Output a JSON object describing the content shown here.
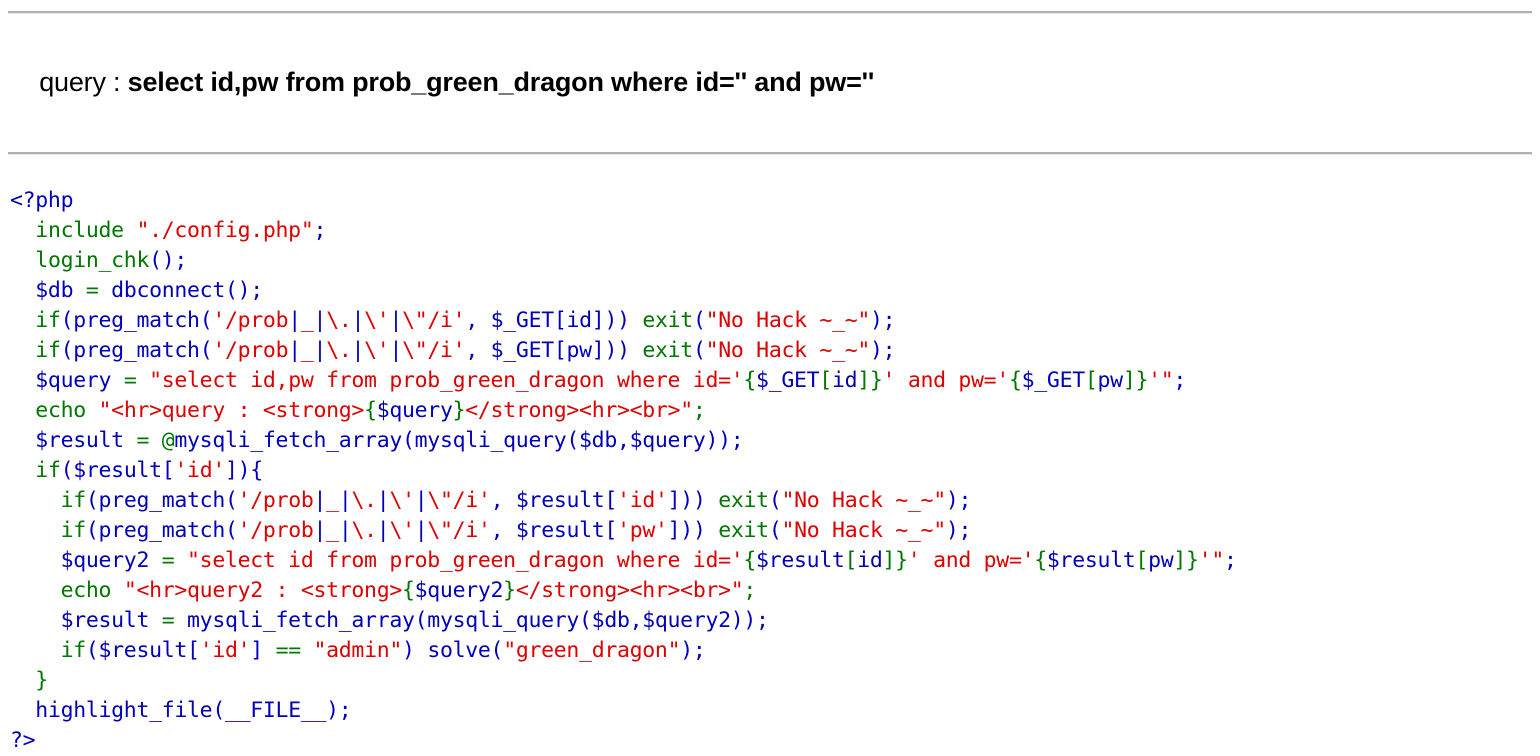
{
  "colors": {
    "keyword_blue": "#0000BB",
    "string_red": "#DD0000",
    "default_green": "#007700",
    "hr_gray": "#b0b0b0",
    "background": "#ffffff",
    "text": "#000000"
  },
  "echo_output": {
    "label": "query : ",
    "query": "select id,pw from prob_green_dragon where id='' and pw=''"
  },
  "source": {
    "open_tag": "<?php",
    "close_tag": "?>",
    "lines": [
      {
        "id": "line-1",
        "text": "<?php"
      },
      {
        "id": "line-2",
        "text": "  include \"./config.php\";"
      },
      {
        "id": "line-3",
        "text": "  login_chk();"
      },
      {
        "id": "line-4",
        "text": "  $db = dbconnect();"
      },
      {
        "id": "line-5",
        "text": "  if(preg_match('/prob|_|\\.|\\'|\\\"/i', $_GET[id])) exit(\"No Hack ~_~\");"
      },
      {
        "id": "line-6",
        "text": "  if(preg_match('/prob|_|\\.|\\'|\\\"/i', $_GET[pw])) exit(\"No Hack ~_~\");"
      },
      {
        "id": "line-7",
        "text": "  $query = \"select id,pw from prob_green_dragon where id='{$_GET[id]}' and pw='{$_GET[pw]}'\";"
      },
      {
        "id": "line-8",
        "text": "  echo \"<hr>query : <strong>{$query}</strong><hr><br>\";"
      },
      {
        "id": "line-9",
        "text": "  $result = @mysqli_fetch_array(mysqli_query($db,$query));"
      },
      {
        "id": "line-10",
        "text": "  if($result['id']){"
      },
      {
        "id": "line-11",
        "text": "    if(preg_match('/prob|_|\\.|\\'|\\\"/i', $result['id'])) exit(\"No Hack ~_~\");"
      },
      {
        "id": "line-12",
        "text": "    if(preg_match('/prob|_|\\.|\\'|\\\"/i', $result['pw'])) exit(\"No Hack ~_~\");"
      },
      {
        "id": "line-13",
        "text": "    $query2 = \"select id from prob_green_dragon where id='{$result[id]}' and pw='{$result[pw]}'\";"
      },
      {
        "id": "line-14",
        "text": "    echo \"<hr>query2 : <strong>{$query2}</strong><hr><br>\";"
      },
      {
        "id": "line-15",
        "text": "    $result = mysqli_fetch_array(mysqli_query($db,$query2));"
      },
      {
        "id": "line-16",
        "text": "    if($result['id'] == \"admin\") solve(\"green_dragon\");"
      },
      {
        "id": "line-17",
        "text": "  }"
      },
      {
        "id": "line-18",
        "text": "  highlight_file(__FILE__);"
      },
      {
        "id": "line-19",
        "text": "?>"
      }
    ],
    "tokens": [
      [
        {
          "c": "b",
          "t": "<?php"
        }
      ],
      [
        {
          "c": "b",
          "t": "  "
        },
        {
          "c": "g",
          "t": "include "
        },
        {
          "c": "r",
          "t": "\"./config.php\""
        },
        {
          "c": "b",
          "t": ";"
        }
      ],
      [
        {
          "c": "b",
          "t": "  "
        },
        {
          "c": "g",
          "t": "login_chk"
        },
        {
          "c": "b",
          "t": "();"
        }
      ],
      [
        {
          "c": "b",
          "t": "  $db "
        },
        {
          "c": "g",
          "t": "= "
        },
        {
          "c": "b",
          "t": "dbconnect();"
        }
      ],
      [
        {
          "c": "b",
          "t": "  "
        },
        {
          "c": "g",
          "t": "if"
        },
        {
          "c": "b",
          "t": "("
        },
        {
          "c": "b",
          "t": "preg_match"
        },
        {
          "c": "b",
          "t": "("
        },
        {
          "c": "r",
          "t": "'/prob"
        },
        {
          "c": "b",
          "t": "|"
        },
        {
          "c": "r",
          "t": "_"
        },
        {
          "c": "b",
          "t": "|"
        },
        {
          "c": "r",
          "t": "\\."
        },
        {
          "c": "b",
          "t": "|"
        },
        {
          "c": "r",
          "t": "\\'"
        },
        {
          "c": "b",
          "t": "|"
        },
        {
          "c": "r",
          "t": "\\\"/i'"
        },
        {
          "c": "b",
          "t": ", $_GET["
        },
        {
          "c": "b",
          "t": "id"
        },
        {
          "c": "b",
          "t": "])) "
        },
        {
          "c": "g",
          "t": "exit"
        },
        {
          "c": "b",
          "t": "("
        },
        {
          "c": "r",
          "t": "\"No Hack ~_~\""
        },
        {
          "c": "b",
          "t": ");"
        }
      ],
      [
        {
          "c": "b",
          "t": "  "
        },
        {
          "c": "g",
          "t": "if"
        },
        {
          "c": "b",
          "t": "("
        },
        {
          "c": "b",
          "t": "preg_match"
        },
        {
          "c": "b",
          "t": "("
        },
        {
          "c": "r",
          "t": "'/prob"
        },
        {
          "c": "b",
          "t": "|"
        },
        {
          "c": "r",
          "t": "_"
        },
        {
          "c": "b",
          "t": "|"
        },
        {
          "c": "r",
          "t": "\\."
        },
        {
          "c": "b",
          "t": "|"
        },
        {
          "c": "r",
          "t": "\\'"
        },
        {
          "c": "b",
          "t": "|"
        },
        {
          "c": "r",
          "t": "\\\"/i'"
        },
        {
          "c": "b",
          "t": ", $_GET["
        },
        {
          "c": "b",
          "t": "pw"
        },
        {
          "c": "b",
          "t": "])) "
        },
        {
          "c": "g",
          "t": "exit"
        },
        {
          "c": "b",
          "t": "("
        },
        {
          "c": "r",
          "t": "\"No Hack ~_~\""
        },
        {
          "c": "b",
          "t": ");"
        }
      ],
      [
        {
          "c": "b",
          "t": "  $query "
        },
        {
          "c": "g",
          "t": "= "
        },
        {
          "c": "r",
          "t": "\"select id,pw from prob_green_dragon where id='"
        },
        {
          "c": "g",
          "t": "{"
        },
        {
          "c": "b",
          "t": "$_GET"
        },
        {
          "c": "g",
          "t": "["
        },
        {
          "c": "b",
          "t": "id"
        },
        {
          "c": "g",
          "t": "]}"
        },
        {
          "c": "r",
          "t": "' and pw='"
        },
        {
          "c": "g",
          "t": "{"
        },
        {
          "c": "b",
          "t": "$_GET"
        },
        {
          "c": "g",
          "t": "["
        },
        {
          "c": "b",
          "t": "pw"
        },
        {
          "c": "g",
          "t": "]}"
        },
        {
          "c": "r",
          "t": "'\""
        },
        {
          "c": "b",
          "t": ";"
        }
      ],
      [
        {
          "c": "b",
          "t": "  "
        },
        {
          "c": "g",
          "t": "echo "
        },
        {
          "c": "r",
          "t": "\"<hr>query : <strong>"
        },
        {
          "c": "g",
          "t": "{"
        },
        {
          "c": "b",
          "t": "$query"
        },
        {
          "c": "g",
          "t": "}"
        },
        {
          "c": "r",
          "t": "</strong><hr><br>\""
        },
        {
          "c": "g",
          "t": ";"
        }
      ],
      [
        {
          "c": "b",
          "t": "  $result "
        },
        {
          "c": "g",
          "t": "= @"
        },
        {
          "c": "b",
          "t": "mysqli_fetch_array"
        },
        {
          "c": "b",
          "t": "("
        },
        {
          "c": "b",
          "t": "mysqli_query"
        },
        {
          "c": "b",
          "t": "($db,$query));"
        }
      ],
      [
        {
          "c": "b",
          "t": "  "
        },
        {
          "c": "g",
          "t": "if"
        },
        {
          "c": "b",
          "t": "($result["
        },
        {
          "c": "r",
          "t": "'id'"
        },
        {
          "c": "b",
          "t": "]){"
        }
      ],
      [
        {
          "c": "b",
          "t": "    "
        },
        {
          "c": "g",
          "t": "if"
        },
        {
          "c": "b",
          "t": "("
        },
        {
          "c": "b",
          "t": "preg_match"
        },
        {
          "c": "b",
          "t": "("
        },
        {
          "c": "r",
          "t": "'/prob"
        },
        {
          "c": "b",
          "t": "|"
        },
        {
          "c": "r",
          "t": "_"
        },
        {
          "c": "b",
          "t": "|"
        },
        {
          "c": "r",
          "t": "\\."
        },
        {
          "c": "b",
          "t": "|"
        },
        {
          "c": "r",
          "t": "\\'"
        },
        {
          "c": "b",
          "t": "|"
        },
        {
          "c": "r",
          "t": "\\\"/i'"
        },
        {
          "c": "b",
          "t": ", $result["
        },
        {
          "c": "r",
          "t": "'id'"
        },
        {
          "c": "b",
          "t": "])) "
        },
        {
          "c": "g",
          "t": "exit"
        },
        {
          "c": "b",
          "t": "("
        },
        {
          "c": "r",
          "t": "\"No Hack ~_~\""
        },
        {
          "c": "b",
          "t": ");"
        }
      ],
      [
        {
          "c": "b",
          "t": "    "
        },
        {
          "c": "g",
          "t": "if"
        },
        {
          "c": "b",
          "t": "("
        },
        {
          "c": "b",
          "t": "preg_match"
        },
        {
          "c": "b",
          "t": "("
        },
        {
          "c": "r",
          "t": "'/prob"
        },
        {
          "c": "b",
          "t": "|"
        },
        {
          "c": "r",
          "t": "_"
        },
        {
          "c": "b",
          "t": "|"
        },
        {
          "c": "r",
          "t": "\\."
        },
        {
          "c": "b",
          "t": "|"
        },
        {
          "c": "r",
          "t": "\\'"
        },
        {
          "c": "b",
          "t": "|"
        },
        {
          "c": "r",
          "t": "\\\"/i'"
        },
        {
          "c": "b",
          "t": ", $result["
        },
        {
          "c": "r",
          "t": "'pw'"
        },
        {
          "c": "b",
          "t": "])) "
        },
        {
          "c": "g",
          "t": "exit"
        },
        {
          "c": "b",
          "t": "("
        },
        {
          "c": "r",
          "t": "\"No Hack ~_~\""
        },
        {
          "c": "b",
          "t": ");"
        }
      ],
      [
        {
          "c": "b",
          "t": "    $query2 "
        },
        {
          "c": "g",
          "t": "= "
        },
        {
          "c": "r",
          "t": "\"select id from prob_green_dragon where id='"
        },
        {
          "c": "g",
          "t": "{"
        },
        {
          "c": "b",
          "t": "$result"
        },
        {
          "c": "g",
          "t": "["
        },
        {
          "c": "b",
          "t": "id"
        },
        {
          "c": "g",
          "t": "]}"
        },
        {
          "c": "r",
          "t": "' and pw='"
        },
        {
          "c": "g",
          "t": "{"
        },
        {
          "c": "b",
          "t": "$result"
        },
        {
          "c": "g",
          "t": "["
        },
        {
          "c": "b",
          "t": "pw"
        },
        {
          "c": "g",
          "t": "]}"
        },
        {
          "c": "r",
          "t": "'\""
        },
        {
          "c": "b",
          "t": ";"
        }
      ],
      [
        {
          "c": "b",
          "t": "    "
        },
        {
          "c": "g",
          "t": "echo "
        },
        {
          "c": "r",
          "t": "\"<hr>query2 : <strong>"
        },
        {
          "c": "g",
          "t": "{"
        },
        {
          "c": "b",
          "t": "$query2"
        },
        {
          "c": "g",
          "t": "}"
        },
        {
          "c": "r",
          "t": "</strong><hr><br>\""
        },
        {
          "c": "g",
          "t": ";"
        }
      ],
      [
        {
          "c": "b",
          "t": "    $result "
        },
        {
          "c": "g",
          "t": "= "
        },
        {
          "c": "b",
          "t": "mysqli_fetch_array"
        },
        {
          "c": "b",
          "t": "("
        },
        {
          "c": "b",
          "t": "mysqli_query"
        },
        {
          "c": "b",
          "t": "($db,$query2));"
        }
      ],
      [
        {
          "c": "b",
          "t": "    "
        },
        {
          "c": "g",
          "t": "if"
        },
        {
          "c": "b",
          "t": "($result["
        },
        {
          "c": "r",
          "t": "'id'"
        },
        {
          "c": "b",
          "t": "] "
        },
        {
          "c": "g",
          "t": "== "
        },
        {
          "c": "r",
          "t": "\"admin\""
        },
        {
          "c": "b",
          "t": ") "
        },
        {
          "c": "b",
          "t": "solve"
        },
        {
          "c": "b",
          "t": "("
        },
        {
          "c": "r",
          "t": "\"green_dragon\""
        },
        {
          "c": "b",
          "t": ");"
        }
      ],
      [
        {
          "c": "b",
          "t": "  "
        },
        {
          "c": "g",
          "t": "}"
        }
      ],
      [
        {
          "c": "b",
          "t": "  "
        },
        {
          "c": "b",
          "t": "highlight_file"
        },
        {
          "c": "b",
          "t": "(__FILE__);"
        }
      ],
      [
        {
          "c": "b",
          "t": "?>"
        }
      ]
    ]
  }
}
